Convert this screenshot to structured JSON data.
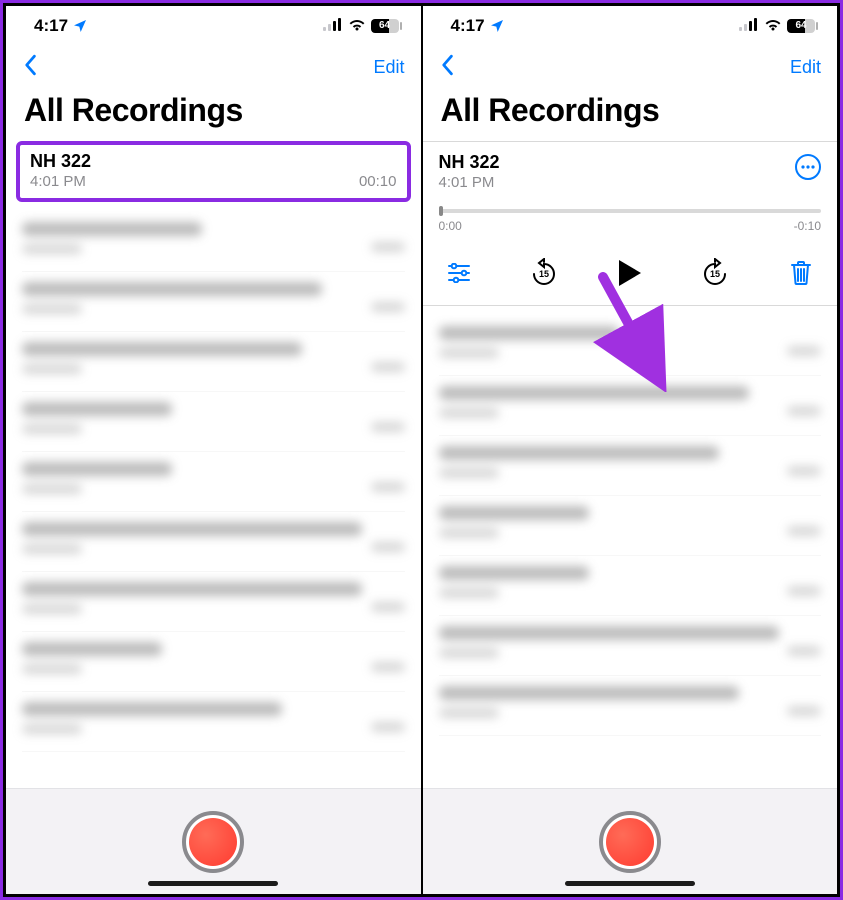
{
  "status": {
    "time": "4:17",
    "battery": "64"
  },
  "nav": {
    "edit_label": "Edit"
  },
  "title": "All Recordings",
  "recording": {
    "title": "NH 322",
    "time": "4:01 PM",
    "duration": "00:10"
  },
  "player": {
    "title": "NH 322",
    "time": "4:01 PM",
    "elapsed": "0:00",
    "remaining": "-0:10"
  },
  "blurred_rows_left": [
    {
      "w1": 180,
      "w2": 60
    },
    {
      "w1": 300,
      "w2": 60
    },
    {
      "w1": 280,
      "w2": 60
    },
    {
      "w1": 150,
      "w2": 60
    },
    {
      "w1": 150,
      "w2": 60
    },
    {
      "w1": 340,
      "w2": 60
    },
    {
      "w1": 340,
      "w2": 60
    },
    {
      "w1": 140,
      "w2": 60
    },
    {
      "w1": 260,
      "w2": 60
    }
  ],
  "blurred_rows_right": [
    {
      "w1": 180,
      "w2": 60
    },
    {
      "w1": 310,
      "w2": 60
    },
    {
      "w1": 280,
      "w2": 60
    },
    {
      "w1": 150,
      "w2": 60
    },
    {
      "w1": 150,
      "w2": 60
    },
    {
      "w1": 340,
      "w2": 60
    },
    {
      "w1": 300,
      "w2": 60
    }
  ]
}
